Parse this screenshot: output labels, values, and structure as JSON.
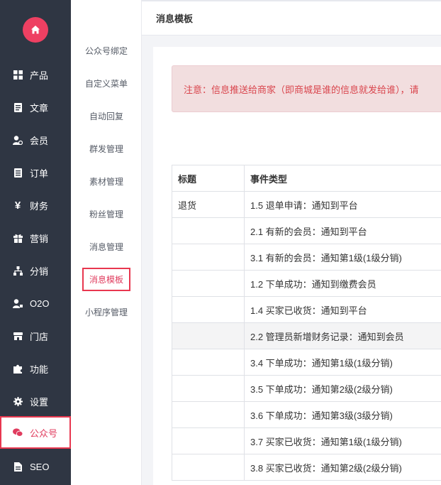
{
  "nav": {
    "items": [
      {
        "label": "产品",
        "icon": "grid-icon"
      },
      {
        "label": "文章",
        "icon": "document-icon"
      },
      {
        "label": "会员",
        "icon": "member-icon"
      },
      {
        "label": "订单",
        "icon": "order-icon"
      },
      {
        "label": "财务",
        "icon": "yen-icon"
      },
      {
        "label": "营销",
        "icon": "gift-icon"
      },
      {
        "label": "分销",
        "icon": "network-icon"
      },
      {
        "label": "O2O",
        "icon": "o2o-icon"
      },
      {
        "label": "门店",
        "icon": "store-icon"
      },
      {
        "label": "功能",
        "icon": "puzzle-icon"
      },
      {
        "label": "设置",
        "icon": "gear-icon"
      },
      {
        "label": "公众号",
        "icon": "wechat-icon"
      },
      {
        "label": "SEO",
        "icon": "seo-icon"
      }
    ],
    "active": "公众号"
  },
  "subnav": {
    "items": [
      "公众号绑定",
      "自定义菜单",
      "自动回复",
      "群发管理",
      "素材管理",
      "粉丝管理",
      "消息管理",
      "消息模板",
      "小程序管理"
    ],
    "active": "消息模板"
  },
  "header": {
    "title": "消息模板"
  },
  "notice": {
    "text": "注意：信息推送给商家（即商城是谁的信息就发给谁），请"
  },
  "table": {
    "headers": [
      "标题",
      "事件类型"
    ],
    "rows": [
      [
        "退货",
        "1.5 退单申请：通知到平台"
      ],
      [
        "",
        "2.1 有新的会员：通知到平台"
      ],
      [
        "",
        "3.1 有新的会员：通知第1级(1级分销)"
      ],
      [
        "",
        "1.2 下单成功：通知到缴费会员"
      ],
      [
        "",
        "1.4 买家已收货：通知到平台"
      ],
      [
        "",
        "2.2 管理员新增财务记录：通知到会员"
      ],
      [
        "",
        "3.4 下单成功：通知第1级(1级分销)"
      ],
      [
        "",
        "3.5 下单成功：通知第2级(2级分销)"
      ],
      [
        "",
        "3.6 下单成功：通知第3级(3级分销)"
      ],
      [
        "",
        "3.7 买家已收货：通知第1级(1级分销)"
      ],
      [
        "",
        "3.8 买家已收货：通知第2级(2级分销)"
      ]
    ],
    "shaded_row": 5
  },
  "colors": {
    "accent": "#e03c5e",
    "sidebar": "#2f3643",
    "notice_bg": "#f2dedf",
    "notice_text": "#d9454d"
  }
}
